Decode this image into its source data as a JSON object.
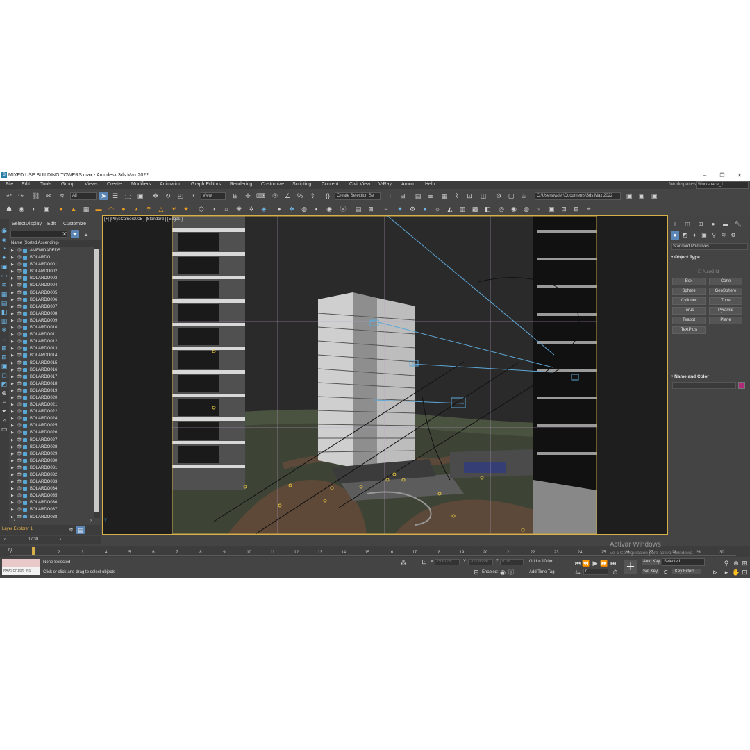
{
  "window": {
    "title": "MIXED USE BUILDING TOWERS.max - Autodesk 3ds Max 2022",
    "app_icon": "3",
    "minimize": "–",
    "maximize": "❐",
    "close": "✕"
  },
  "menubar": {
    "items": [
      "File",
      "Edit",
      "Tools",
      "Group",
      "Views",
      "Create",
      "Modifiers",
      "Animation",
      "Graph Editors",
      "Rendering",
      "Customize",
      "Scripting",
      "Content",
      "Civil View",
      "V-Ray",
      "Arnold",
      "Help"
    ],
    "workspaces_label": "Workspaces:",
    "workspace_value": "Workspace_1"
  },
  "toolbar": {
    "filter_value": "All",
    "refcoord_value": "View",
    "selection_set_placeholder": "Create Selection Se",
    "project_path": "C:\\Users\\valer\\Documents\\3ds Max 2022"
  },
  "explorer": {
    "menu": [
      "Select",
      "Display",
      "Edit",
      "Customize"
    ],
    "column_header": "Name (Sorted Ascending)",
    "objects": [
      "AMENIDADEDS",
      "BOLARDO",
      "BOLARDO001",
      "BOLARDO002",
      "BOLARDO003",
      "BOLARDO004",
      "BOLARDO005",
      "BOLARDO006",
      "BOLARDO007",
      "BOLARDO008",
      "BOLARDO009",
      "BOLARDO010",
      "BOLARDO011",
      "BOLARDO012",
      "BOLARDO013",
      "BOLARDO014",
      "BOLARDO015",
      "BOLARDO016",
      "BOLARDO017",
      "BOLARDO018",
      "BOLARDO019",
      "BOLARDO020",
      "BOLARDO021",
      "BOLARDO022",
      "BOLARDO024",
      "BOLARDO025",
      "BOLARDO026",
      "BOLARDO027",
      "BOLARDO028",
      "BOLARDO029",
      "BOLARDO030",
      "BOLARDO031",
      "BOLARDO032",
      "BOLARDO033",
      "BOLARDO034",
      "BOLARDO035",
      "BOLARDO036",
      "BOLARDO037",
      "BOLARDO038"
    ],
    "layer_explorer": "Layer Explorer 1",
    "frame_counter": "0 / 30"
  },
  "viewport": {
    "label": "[+] [PhysCamera005 ] [Standard ] [Edges ]"
  },
  "command_panel": {
    "category": "Standard Primitives",
    "object_type_title": "Object Type",
    "autogrid": "AutoGrid",
    "buttons": [
      "Box",
      "Cone",
      "Sphere",
      "GeoSphere",
      "Cylinder",
      "Tube",
      "Torus",
      "Pyramid",
      "Teapot",
      "Plane",
      "TextPlus"
    ],
    "name_color_title": "Name and Color",
    "swatch_color": "#b02a7a"
  },
  "timeline": {
    "ticks": [
      "0",
      "1",
      "2",
      "3",
      "4",
      "5",
      "6",
      "7",
      "8",
      "9",
      "10",
      "11",
      "12",
      "13",
      "14",
      "15",
      "16",
      "17",
      "18",
      "19",
      "20",
      "21",
      "22",
      "23",
      "24",
      "25",
      "26",
      "27",
      "28",
      "29",
      "30"
    ]
  },
  "status": {
    "maxscript": "MAXScript Mi",
    "selection": "None Selected",
    "prompt": "Click or click-and-drag to select objects",
    "x_label": "X:",
    "x_value": "79.612m",
    "y_label": "Y:",
    "y_value": "-115.865m",
    "z_label": "Z:",
    "z_value": "0.0m",
    "grid": "Grid = 10.0m",
    "enabled": "Enabled:",
    "add_time_tag": "Add Time Tag",
    "auto_key": "Auto Key",
    "selected": "Selected",
    "set_key": "Set Key",
    "key_filters": "Key Filters...",
    "frame_field": "0"
  },
  "watermark": {
    "line1": "Activar Windows",
    "line2": "Ve a Configuración para activar Windows."
  }
}
